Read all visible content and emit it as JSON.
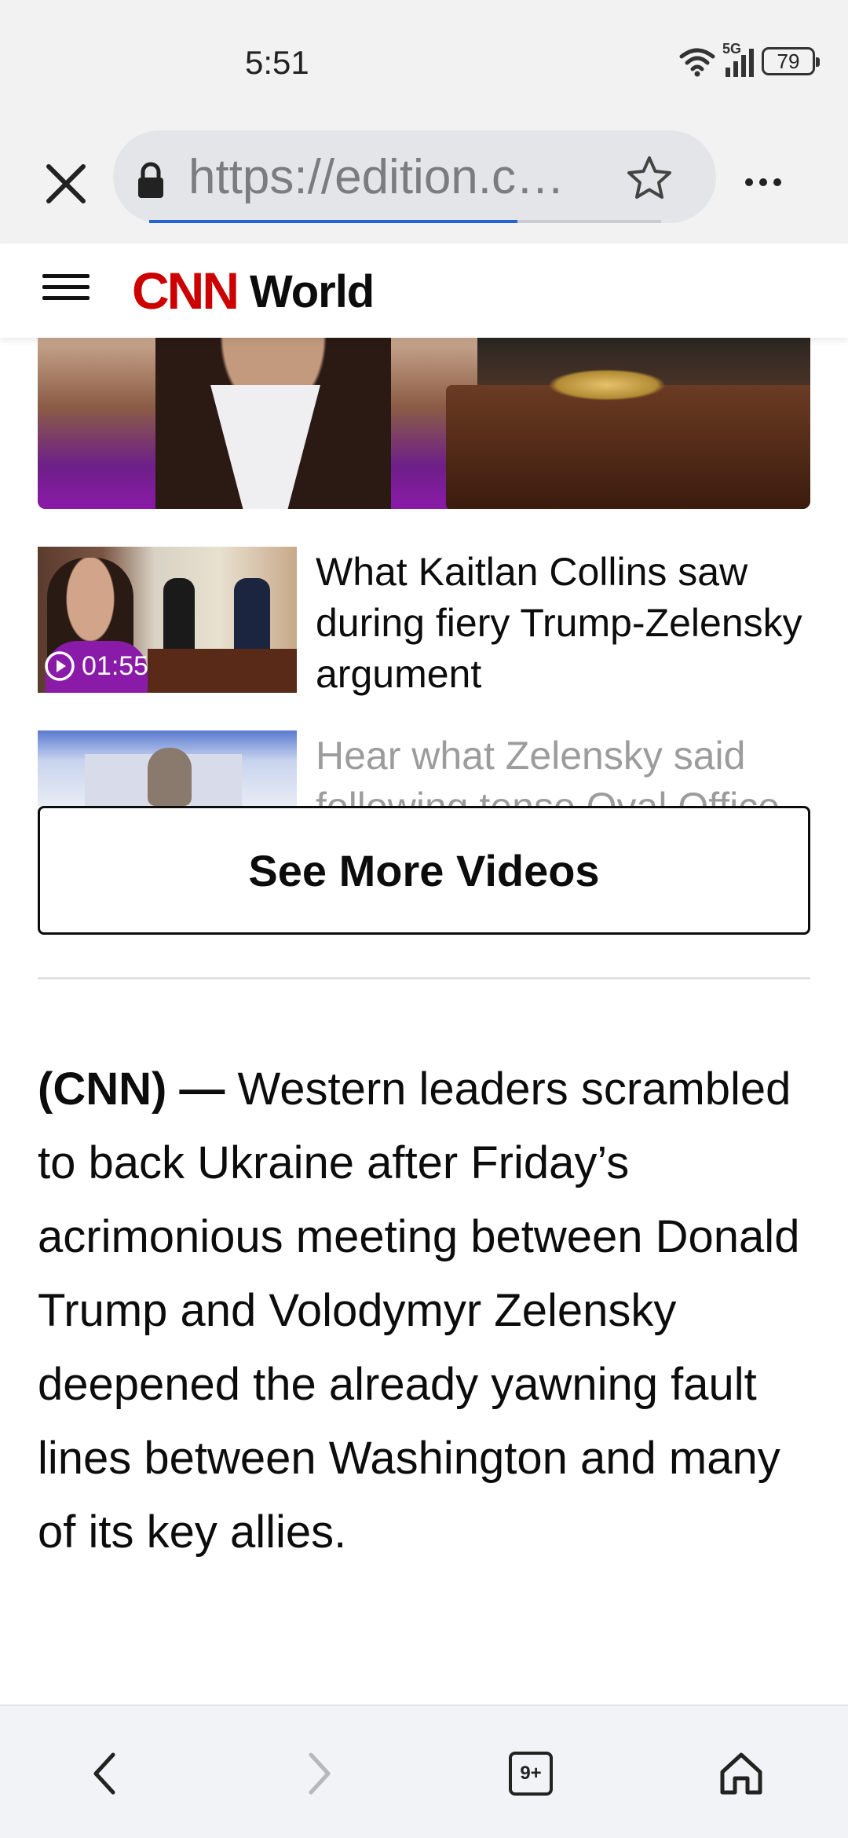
{
  "status_bar": {
    "time": "5:51",
    "network": "5G",
    "battery": "79"
  },
  "browser": {
    "url": "https://edition.cnn.com",
    "load_progress_percent": 72,
    "tab_count": "9+"
  },
  "site_header": {
    "logo": "CNN",
    "section": "World"
  },
  "videos": [
    {
      "title": "What Kaitlan Collins saw during fiery Trump-Zelensky argument",
      "duration": "01:55"
    },
    {
      "title": "Hear what Zelensky said following tense Oval Office"
    }
  ],
  "see_more_label": "See More Videos",
  "article": {
    "dateline": "(CNN) —",
    "text": "Western leaders scrambled to back Ukraine after Friday’s acrimonious meeting between Donald Trump and Volodymyr Zelensky deepened the already yawning fault lines between Washington and many of its key allies."
  },
  "colors": {
    "cnn_red": "#cc0000",
    "progress_blue": "#2563d0",
    "browser_chrome": "#f2f2f2"
  },
  "icons": [
    "close-icon",
    "lock-icon",
    "star-icon",
    "more-icon",
    "menu-icon",
    "play-icon",
    "back-icon",
    "forward-icon",
    "tabs-icon",
    "home-icon",
    "wifi-icon",
    "signal-icon",
    "battery-icon"
  ]
}
